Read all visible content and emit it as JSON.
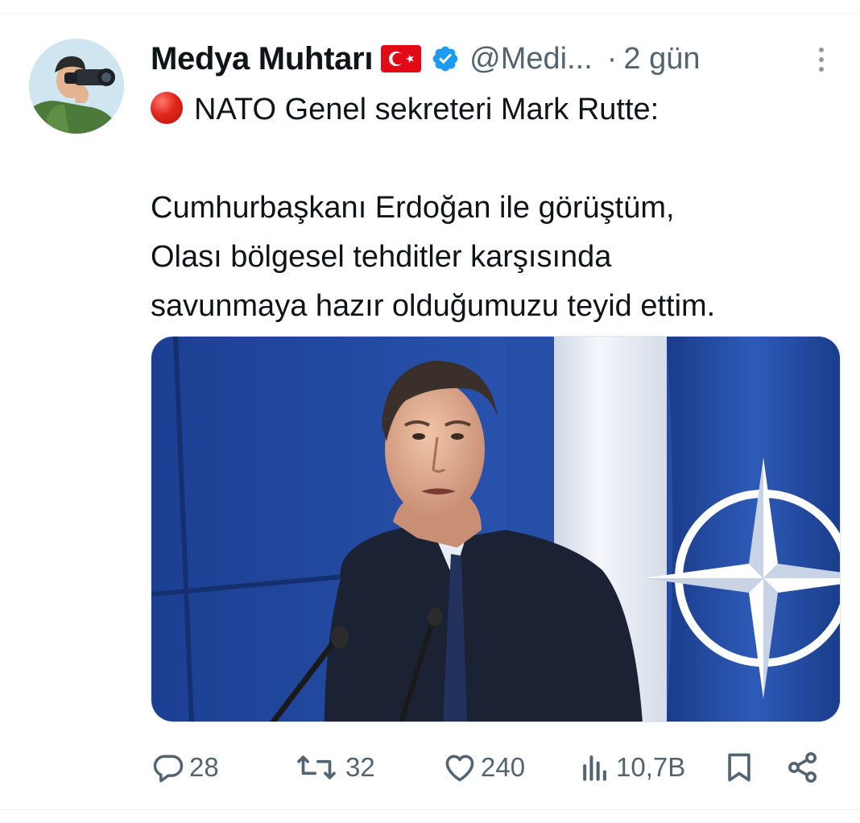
{
  "tweet": {
    "author_name": "Medya Muhtarı",
    "handle": "@Medi...",
    "separator": "·",
    "time": "2 gün",
    "text_line_1": "NATO  Genel sekreteri Mark Rutte:",
    "text_line_2": "Cumhurbaşkanı Erdoğan ile görüştüm,",
    "text_line_3": "Olası bölgesel tehditler karşısında",
    "text_line_4": "savunmaya hazır olduğumuzu teyid ettim."
  },
  "icons": {
    "flag": "turkey-flag-icon",
    "verified": "verified-badge-icon",
    "more": "more-options-icon",
    "bullet": "red-circle-icon",
    "reply": "reply-icon",
    "retweet": "retweet-icon",
    "like": "heart-icon",
    "views": "views-icon",
    "bookmark": "bookmark-icon",
    "share": "share-icon"
  },
  "actions": {
    "replies": "28",
    "retweets": "32",
    "likes": "240",
    "views": "10,7B"
  },
  "colors": {
    "text_primary": "#0f1419",
    "text_secondary": "#536471",
    "verified_blue": "#1d9bf0",
    "nato_blue": "#1f3f8f"
  }
}
